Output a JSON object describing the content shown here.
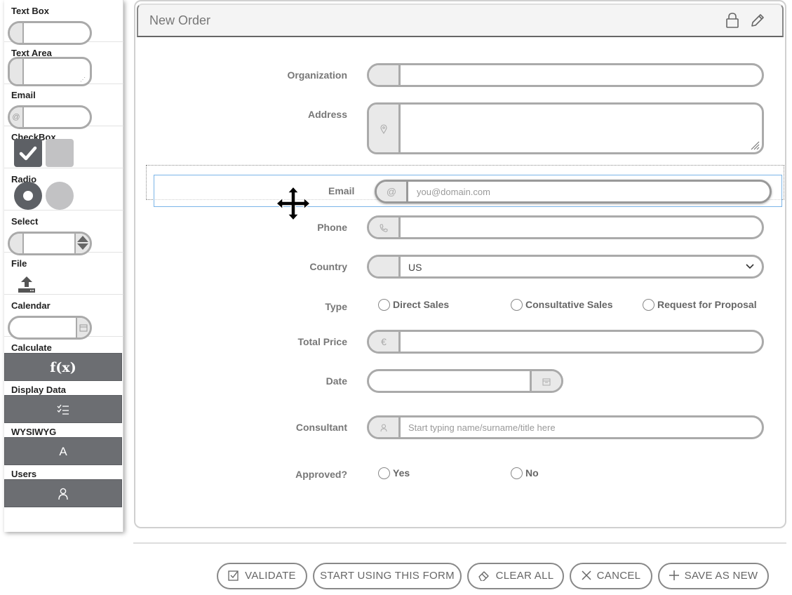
{
  "palette": {
    "items": [
      {
        "label": "Text Box"
      },
      {
        "label": "Text Area"
      },
      {
        "label": "Email",
        "addon": "@"
      },
      {
        "label": "CheckBox"
      },
      {
        "label": "Radio"
      },
      {
        "label": "Select"
      },
      {
        "label": "File"
      },
      {
        "label": "Calendar"
      },
      {
        "label": "Calculate",
        "button_text": "f(x)"
      },
      {
        "label": "Display Data"
      },
      {
        "label": "WYSIWYG",
        "button_text": "A"
      },
      {
        "label": "Users"
      }
    ]
  },
  "form": {
    "title": "New Order",
    "fields": {
      "organization": {
        "label": "Organization",
        "value": ""
      },
      "address": {
        "label": "Address",
        "value": ""
      },
      "email": {
        "label": "Email",
        "placeholder": "you@domain.com"
      },
      "phone": {
        "label": "Phone",
        "value": ""
      },
      "country": {
        "label": "Country",
        "value": "US"
      },
      "type": {
        "label": "Type",
        "options": [
          "Direct Sales",
          "Consultative Sales",
          "Request for Proposal"
        ]
      },
      "total_price": {
        "label": "Total Price",
        "addon": "€",
        "value": ""
      },
      "date": {
        "label": "Date",
        "value": ""
      },
      "consultant": {
        "label": "Consultant",
        "placeholder": "Start typing name/surname/title here"
      },
      "approved": {
        "label": "Approved?",
        "options": [
          "Yes",
          "No"
        ]
      }
    }
  },
  "actions": {
    "validate": "VALIDATE",
    "start_using": "START USING THIS FORM",
    "clear_all": "CLEAR ALL",
    "cancel": "CANCEL",
    "save_as_new": "SAVE AS NEW"
  },
  "colors": {
    "palette_button": "#6c6e72",
    "field_border": "#aaaaaa",
    "selection_border": "#7ab4e8"
  }
}
